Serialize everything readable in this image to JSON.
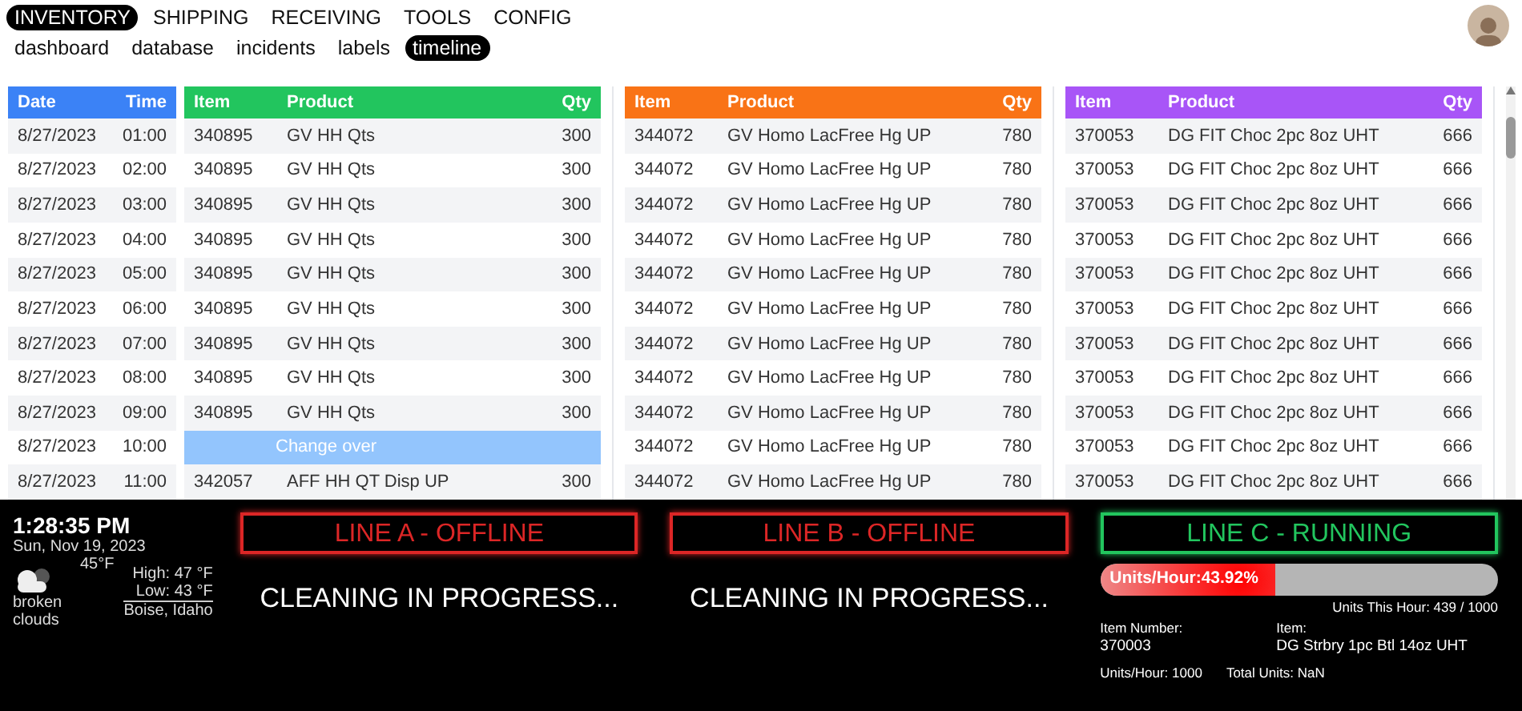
{
  "main_nav": [
    {
      "label": "INVENTORY",
      "selected": true
    },
    {
      "label": "SHIPPING",
      "selected": false
    },
    {
      "label": "RECEIVING",
      "selected": false
    },
    {
      "label": "TOOLS",
      "selected": false
    },
    {
      "label": "CONFIG",
      "selected": false
    }
  ],
  "sub_nav": [
    {
      "label": "dashboard",
      "selected": false
    },
    {
      "label": "database",
      "selected": false
    },
    {
      "label": "incidents",
      "selected": false
    },
    {
      "label": "labels",
      "selected": false
    },
    {
      "label": "timeline",
      "selected": true
    }
  ],
  "schedule": {
    "color": "#3b82f6",
    "columns": [
      "Date",
      "Time"
    ],
    "rows": [
      [
        "8/27/2023",
        "01:00"
      ],
      [
        "8/27/2023",
        "02:00"
      ],
      [
        "8/27/2023",
        "03:00"
      ],
      [
        "8/27/2023",
        "04:00"
      ],
      [
        "8/27/2023",
        "05:00"
      ],
      [
        "8/27/2023",
        "06:00"
      ],
      [
        "8/27/2023",
        "07:00"
      ],
      [
        "8/27/2023",
        "08:00"
      ],
      [
        "8/27/2023",
        "09:00"
      ],
      [
        "8/27/2023",
        "10:00"
      ],
      [
        "8/27/2023",
        "11:00"
      ]
    ]
  },
  "lines": [
    {
      "color": "#22c55e",
      "columns": [
        "Item",
        "Product",
        "Qty"
      ],
      "rows": [
        {
          "kind": "product",
          "cells": [
            "340895",
            "GV HH Qts",
            "300"
          ]
        },
        {
          "kind": "product",
          "cells": [
            "340895",
            "GV HH Qts",
            "300"
          ]
        },
        {
          "kind": "product",
          "cells": [
            "340895",
            "GV HH Qts",
            "300"
          ]
        },
        {
          "kind": "product",
          "cells": [
            "340895",
            "GV HH Qts",
            "300"
          ]
        },
        {
          "kind": "product",
          "cells": [
            "340895",
            "GV HH Qts",
            "300"
          ]
        },
        {
          "kind": "product",
          "cells": [
            "340895",
            "GV HH Qts",
            "300"
          ]
        },
        {
          "kind": "product",
          "cells": [
            "340895",
            "GV HH Qts",
            "300"
          ]
        },
        {
          "kind": "product",
          "cells": [
            "340895",
            "GV HH Qts",
            "300"
          ]
        },
        {
          "kind": "product",
          "cells": [
            "340895",
            "GV HH Qts",
            "300"
          ]
        },
        {
          "kind": "changeover",
          "label": "Change over"
        },
        {
          "kind": "product",
          "cells": [
            "342057",
            "AFF HH QT Disp UP",
            "300"
          ]
        }
      ]
    },
    {
      "color": "#f97316",
      "columns": [
        "Item",
        "Product",
        "Qty"
      ],
      "rows": [
        {
          "kind": "product",
          "cells": [
            "344072",
            "GV Homo LacFree Hg UP",
            "780"
          ]
        },
        {
          "kind": "product",
          "cells": [
            "344072",
            "GV Homo LacFree Hg UP",
            "780"
          ]
        },
        {
          "kind": "product",
          "cells": [
            "344072",
            "GV Homo LacFree Hg UP",
            "780"
          ]
        },
        {
          "kind": "product",
          "cells": [
            "344072",
            "GV Homo LacFree Hg UP",
            "780"
          ]
        },
        {
          "kind": "product",
          "cells": [
            "344072",
            "GV Homo LacFree Hg UP",
            "780"
          ]
        },
        {
          "kind": "product",
          "cells": [
            "344072",
            "GV Homo LacFree Hg UP",
            "780"
          ]
        },
        {
          "kind": "product",
          "cells": [
            "344072",
            "GV Homo LacFree Hg UP",
            "780"
          ]
        },
        {
          "kind": "product",
          "cells": [
            "344072",
            "GV Homo LacFree Hg UP",
            "780"
          ]
        },
        {
          "kind": "product",
          "cells": [
            "344072",
            "GV Homo LacFree Hg UP",
            "780"
          ]
        },
        {
          "kind": "product",
          "cells": [
            "344072",
            "GV Homo LacFree Hg UP",
            "780"
          ]
        },
        {
          "kind": "product",
          "cells": [
            "344072",
            "GV Homo LacFree Hg UP",
            "780"
          ]
        }
      ]
    },
    {
      "color": "#a855f7",
      "columns": [
        "Item",
        "Product",
        "Qty"
      ],
      "rows": [
        {
          "kind": "product",
          "cells": [
            "370053",
            "DG FIT Choc 2pc 8oz UHT",
            "666"
          ]
        },
        {
          "kind": "product",
          "cells": [
            "370053",
            "DG FIT Choc 2pc 8oz UHT",
            "666"
          ]
        },
        {
          "kind": "product",
          "cells": [
            "370053",
            "DG FIT Choc 2pc 8oz UHT",
            "666"
          ]
        },
        {
          "kind": "product",
          "cells": [
            "370053",
            "DG FIT Choc 2pc 8oz UHT",
            "666"
          ]
        },
        {
          "kind": "product",
          "cells": [
            "370053",
            "DG FIT Choc 2pc 8oz UHT",
            "666"
          ]
        },
        {
          "kind": "product",
          "cells": [
            "370053",
            "DG FIT Choc 2pc 8oz UHT",
            "666"
          ]
        },
        {
          "kind": "product",
          "cells": [
            "370053",
            "DG FIT Choc 2pc 8oz UHT",
            "666"
          ]
        },
        {
          "kind": "product",
          "cells": [
            "370053",
            "DG FIT Choc 2pc 8oz UHT",
            "666"
          ]
        },
        {
          "kind": "product",
          "cells": [
            "370053",
            "DG FIT Choc 2pc 8oz UHT",
            "666"
          ]
        },
        {
          "kind": "product",
          "cells": [
            "370053",
            "DG FIT Choc 2pc 8oz UHT",
            "666"
          ]
        },
        {
          "kind": "product",
          "cells": [
            "370053",
            "DG FIT Choc 2pc 8oz UHT",
            "666"
          ]
        }
      ]
    }
  ],
  "info": {
    "time": "1:28:35 PM",
    "date": "Sun, Nov 19, 2023",
    "temperature": "45°F",
    "high": "High: 47 °F",
    "low": "Low: 43 °F",
    "location": "Boise, Idaho",
    "condition": "broken clouds"
  },
  "statuses": [
    {
      "title": "LINE A - OFFLINE",
      "kind": "offline",
      "message": "CLEANING IN PROGRESS..."
    },
    {
      "title": "LINE B - OFFLINE",
      "kind": "offline",
      "message": "CLEANING IN PROGRESS..."
    },
    {
      "title": "LINE C - RUNNING",
      "kind": "running",
      "progress_label": "Units/Hour:43.92%",
      "level": 0.4392,
      "units_this_hour": "Units This Hour: 439 / 1000",
      "item_number_label": "Item Number:",
      "item_number": "370003",
      "item_label": "Item:",
      "item": "DG Strbry 1pc Btl 14oz UHT",
      "units_per_hour": "Units/Hour: 1000",
      "total_units": "Total Units: NaN"
    }
  ]
}
